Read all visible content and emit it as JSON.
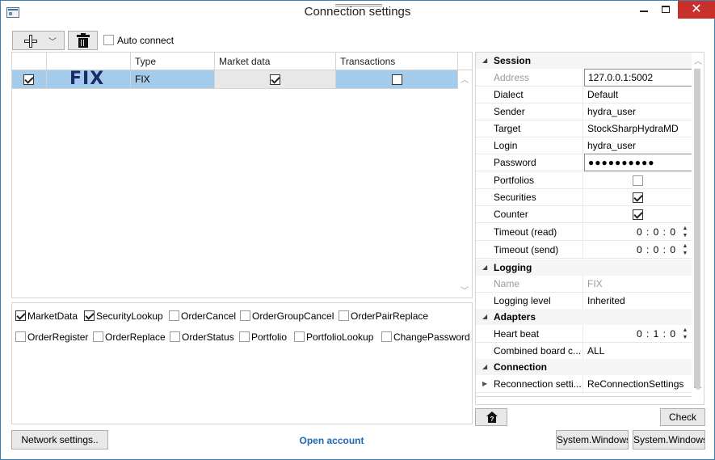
{
  "window": {
    "title": "Connection settings"
  },
  "toolbar": {
    "auto_connect_label": "Auto connect",
    "auto_connect_checked": false
  },
  "grid": {
    "columns": [
      "",
      "",
      "Type",
      "Market data",
      "Transactions"
    ],
    "rows": [
      {
        "enabled": true,
        "logo": "FIX",
        "type": "FIX",
        "market_data": true,
        "transactions": false
      }
    ]
  },
  "message_types": [
    {
      "label": "MarketData",
      "checked": true
    },
    {
      "label": "SecurityLookup",
      "checked": true
    },
    {
      "label": "OrderCancel",
      "checked": false
    },
    {
      "label": "OrderGroupCancel",
      "checked": false
    },
    {
      "label": "OrderPairReplace",
      "checked": false
    },
    {
      "label": "OrderRegister",
      "checked": false
    },
    {
      "label": "OrderReplace",
      "checked": false
    },
    {
      "label": "OrderStatus",
      "checked": false
    },
    {
      "label": "Portfolio",
      "checked": false
    },
    {
      "label": "PortfolioLookup",
      "checked": false
    },
    {
      "label": "ChangePassword",
      "checked": false
    }
  ],
  "properties": {
    "session": {
      "title": "Session",
      "address": {
        "name": "Address",
        "value": "127.0.0.1:5002"
      },
      "dialect": {
        "name": "Dialect",
        "value": "Default"
      },
      "sender": {
        "name": "Sender",
        "value": "hydra_user"
      },
      "target": {
        "name": "Target",
        "value": "StockSharpHydraMD"
      },
      "login": {
        "name": "Login",
        "value": "hydra_user"
      },
      "password": {
        "name": "Password",
        "value": "●●●●●●●●●●"
      },
      "portfolios": {
        "name": "Portfolios",
        "checked": false
      },
      "securities": {
        "name": "Securities",
        "checked": true
      },
      "counter": {
        "name": "Counter",
        "checked": true
      },
      "timeout_read": {
        "name": "Timeout (read)",
        "value": "0 : 0 : 0"
      },
      "timeout_send": {
        "name": "Timeout (send)",
        "value": "0 : 0 : 0"
      }
    },
    "logging": {
      "title": "Logging",
      "name": {
        "name": "Name",
        "value": "FIX"
      },
      "level": {
        "name": "Logging level",
        "value": "Inherited"
      }
    },
    "adapters": {
      "title": "Adapters",
      "heart_beat": {
        "name": "Heart beat",
        "value": "0 : 1 : 0"
      },
      "combined_board": {
        "name": "Combined board c...",
        "value": "ALL"
      }
    },
    "connection": {
      "title": "Connection",
      "reconnection": {
        "name": "Reconnection setti...",
        "value": "ReConnectionSettings"
      }
    }
  },
  "buttons": {
    "check": "Check",
    "network_settings": "Network settings..",
    "open_account": "Open account",
    "system1": "System.Windows.Forms.Button",
    "system2": "System.Windows.Forms.Button"
  },
  "icons": {
    "add": "plus-icon",
    "delete": "trash-icon",
    "help": "home-help-icon"
  },
  "colors": {
    "selection": "#a5cbeb",
    "close_button": "#c7302b",
    "link": "#2067b6",
    "fix_logo": "#1b2a6b"
  }
}
